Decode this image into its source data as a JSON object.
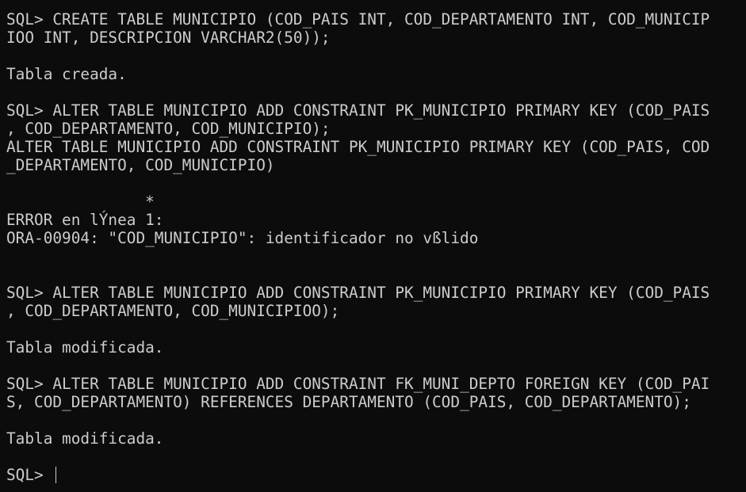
{
  "terminal": {
    "lines": [
      "SQL> CREATE TABLE MUNICIPIO (COD_PAIS INT, COD_DEPARTAMENTO INT, COD_MUNICIP",
      "IOO INT, DESCRIPCION VARCHAR2(50));",
      "",
      "Tabla creada.",
      "",
      "SQL> ALTER TABLE MUNICIPIO ADD CONSTRAINT PK_MUNICIPIO PRIMARY KEY (COD_PAIS",
      ", COD_DEPARTAMENTO, COD_MUNICIPIO);",
      "ALTER TABLE MUNICIPIO ADD CONSTRAINT PK_MUNICIPIO PRIMARY KEY (COD_PAIS, COD",
      "_DEPARTAMENTO, COD_MUNICIPIO)",
      "",
      "               *",
      "ERROR en lÝnea 1:",
      "ORA-00904: \"COD_MUNICIPIO\": identificador no vßlido",
      "",
      "",
      "SQL> ALTER TABLE MUNICIPIO ADD CONSTRAINT PK_MUNICIPIO PRIMARY KEY (COD_PAIS",
      ", COD_DEPARTAMENTO, COD_MUNICIPIOO);",
      "",
      "Tabla modificada.",
      "",
      "SQL> ALTER TABLE MUNICIPIO ADD CONSTRAINT FK_MUNI_DEPTO FOREIGN KEY (COD_PAI",
      "S, COD_DEPARTAMENTO) REFERENCES DEPARTAMENTO (COD_PAIS, COD_DEPARTAMENTO);",
      "",
      "Tabla modificada.",
      "",
      "SQL> "
    ]
  }
}
